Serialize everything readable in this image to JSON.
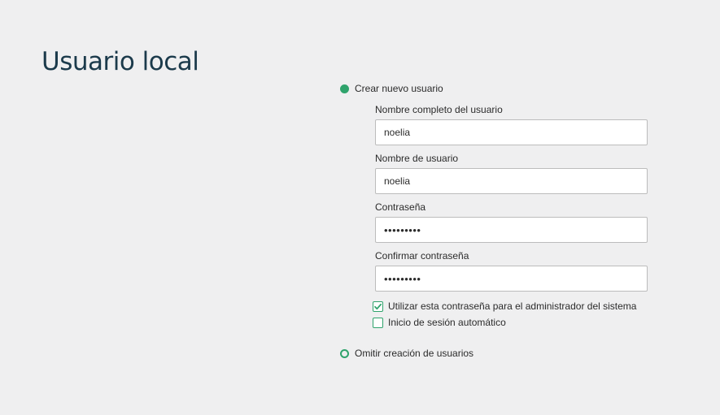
{
  "page": {
    "title": "Usuario local"
  },
  "options": {
    "create_user": {
      "label": "Crear nuevo usuario",
      "selected": true
    },
    "skip_user": {
      "label": "Omitir creación de usuarios",
      "selected": false
    }
  },
  "form": {
    "full_name": {
      "label": "Nombre completo del usuario",
      "value": "noelia"
    },
    "username": {
      "label": "Nombre de usuario",
      "value": "noelia"
    },
    "password": {
      "label": "Contraseña",
      "value": "•••••••••"
    },
    "confirm_password": {
      "label": "Confirmar contraseña",
      "value": "•••••••••"
    }
  },
  "checkboxes": {
    "use_for_admin": {
      "label": "Utilizar esta contraseña para el administrador del sistema",
      "checked": true
    },
    "auto_login": {
      "label": "Inicio de sesión automático",
      "checked": false
    }
  },
  "colors": {
    "accent": "#2fa36c",
    "title": "#1b3a4b",
    "background": "#efeff0"
  }
}
